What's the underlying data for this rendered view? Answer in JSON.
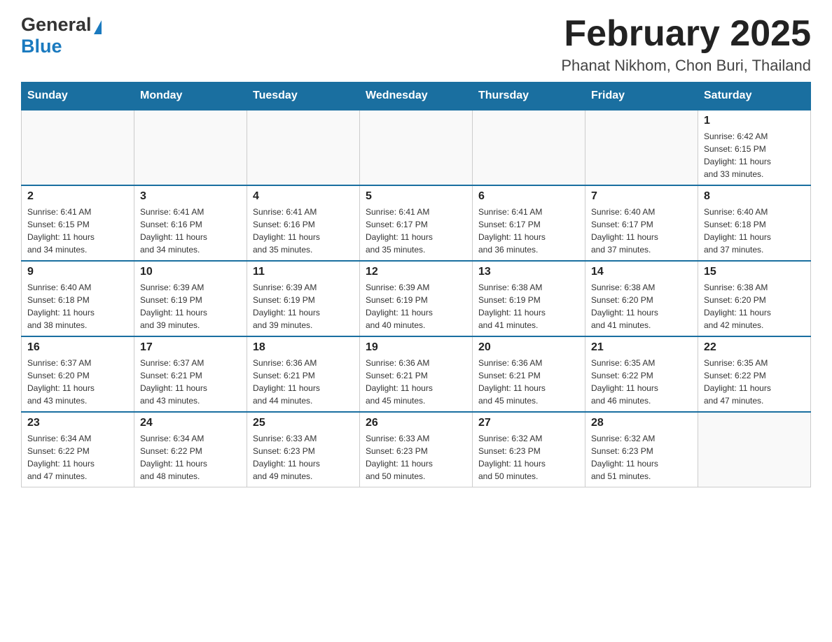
{
  "header": {
    "logo_general": "General",
    "logo_blue": "Blue",
    "title": "February 2025",
    "subtitle": "Phanat Nikhom, Chon Buri, Thailand"
  },
  "calendar": {
    "days_of_week": [
      "Sunday",
      "Monday",
      "Tuesday",
      "Wednesday",
      "Thursday",
      "Friday",
      "Saturday"
    ],
    "weeks": [
      {
        "days": [
          {
            "num": "",
            "info": ""
          },
          {
            "num": "",
            "info": ""
          },
          {
            "num": "",
            "info": ""
          },
          {
            "num": "",
            "info": ""
          },
          {
            "num": "",
            "info": ""
          },
          {
            "num": "",
            "info": ""
          },
          {
            "num": "1",
            "info": "Sunrise: 6:42 AM\nSunset: 6:15 PM\nDaylight: 11 hours\nand 33 minutes."
          }
        ]
      },
      {
        "days": [
          {
            "num": "2",
            "info": "Sunrise: 6:41 AM\nSunset: 6:15 PM\nDaylight: 11 hours\nand 34 minutes."
          },
          {
            "num": "3",
            "info": "Sunrise: 6:41 AM\nSunset: 6:16 PM\nDaylight: 11 hours\nand 34 minutes."
          },
          {
            "num": "4",
            "info": "Sunrise: 6:41 AM\nSunset: 6:16 PM\nDaylight: 11 hours\nand 35 minutes."
          },
          {
            "num": "5",
            "info": "Sunrise: 6:41 AM\nSunset: 6:17 PM\nDaylight: 11 hours\nand 35 minutes."
          },
          {
            "num": "6",
            "info": "Sunrise: 6:41 AM\nSunset: 6:17 PM\nDaylight: 11 hours\nand 36 minutes."
          },
          {
            "num": "7",
            "info": "Sunrise: 6:40 AM\nSunset: 6:17 PM\nDaylight: 11 hours\nand 37 minutes."
          },
          {
            "num": "8",
            "info": "Sunrise: 6:40 AM\nSunset: 6:18 PM\nDaylight: 11 hours\nand 37 minutes."
          }
        ]
      },
      {
        "days": [
          {
            "num": "9",
            "info": "Sunrise: 6:40 AM\nSunset: 6:18 PM\nDaylight: 11 hours\nand 38 minutes."
          },
          {
            "num": "10",
            "info": "Sunrise: 6:39 AM\nSunset: 6:19 PM\nDaylight: 11 hours\nand 39 minutes."
          },
          {
            "num": "11",
            "info": "Sunrise: 6:39 AM\nSunset: 6:19 PM\nDaylight: 11 hours\nand 39 minutes."
          },
          {
            "num": "12",
            "info": "Sunrise: 6:39 AM\nSunset: 6:19 PM\nDaylight: 11 hours\nand 40 minutes."
          },
          {
            "num": "13",
            "info": "Sunrise: 6:38 AM\nSunset: 6:19 PM\nDaylight: 11 hours\nand 41 minutes."
          },
          {
            "num": "14",
            "info": "Sunrise: 6:38 AM\nSunset: 6:20 PM\nDaylight: 11 hours\nand 41 minutes."
          },
          {
            "num": "15",
            "info": "Sunrise: 6:38 AM\nSunset: 6:20 PM\nDaylight: 11 hours\nand 42 minutes."
          }
        ]
      },
      {
        "days": [
          {
            "num": "16",
            "info": "Sunrise: 6:37 AM\nSunset: 6:20 PM\nDaylight: 11 hours\nand 43 minutes."
          },
          {
            "num": "17",
            "info": "Sunrise: 6:37 AM\nSunset: 6:21 PM\nDaylight: 11 hours\nand 43 minutes."
          },
          {
            "num": "18",
            "info": "Sunrise: 6:36 AM\nSunset: 6:21 PM\nDaylight: 11 hours\nand 44 minutes."
          },
          {
            "num": "19",
            "info": "Sunrise: 6:36 AM\nSunset: 6:21 PM\nDaylight: 11 hours\nand 45 minutes."
          },
          {
            "num": "20",
            "info": "Sunrise: 6:36 AM\nSunset: 6:21 PM\nDaylight: 11 hours\nand 45 minutes."
          },
          {
            "num": "21",
            "info": "Sunrise: 6:35 AM\nSunset: 6:22 PM\nDaylight: 11 hours\nand 46 minutes."
          },
          {
            "num": "22",
            "info": "Sunrise: 6:35 AM\nSunset: 6:22 PM\nDaylight: 11 hours\nand 47 minutes."
          }
        ]
      },
      {
        "days": [
          {
            "num": "23",
            "info": "Sunrise: 6:34 AM\nSunset: 6:22 PM\nDaylight: 11 hours\nand 47 minutes."
          },
          {
            "num": "24",
            "info": "Sunrise: 6:34 AM\nSunset: 6:22 PM\nDaylight: 11 hours\nand 48 minutes."
          },
          {
            "num": "25",
            "info": "Sunrise: 6:33 AM\nSunset: 6:23 PM\nDaylight: 11 hours\nand 49 minutes."
          },
          {
            "num": "26",
            "info": "Sunrise: 6:33 AM\nSunset: 6:23 PM\nDaylight: 11 hours\nand 50 minutes."
          },
          {
            "num": "27",
            "info": "Sunrise: 6:32 AM\nSunset: 6:23 PM\nDaylight: 11 hours\nand 50 minutes."
          },
          {
            "num": "28",
            "info": "Sunrise: 6:32 AM\nSunset: 6:23 PM\nDaylight: 11 hours\nand 51 minutes."
          },
          {
            "num": "",
            "info": ""
          }
        ]
      }
    ]
  }
}
